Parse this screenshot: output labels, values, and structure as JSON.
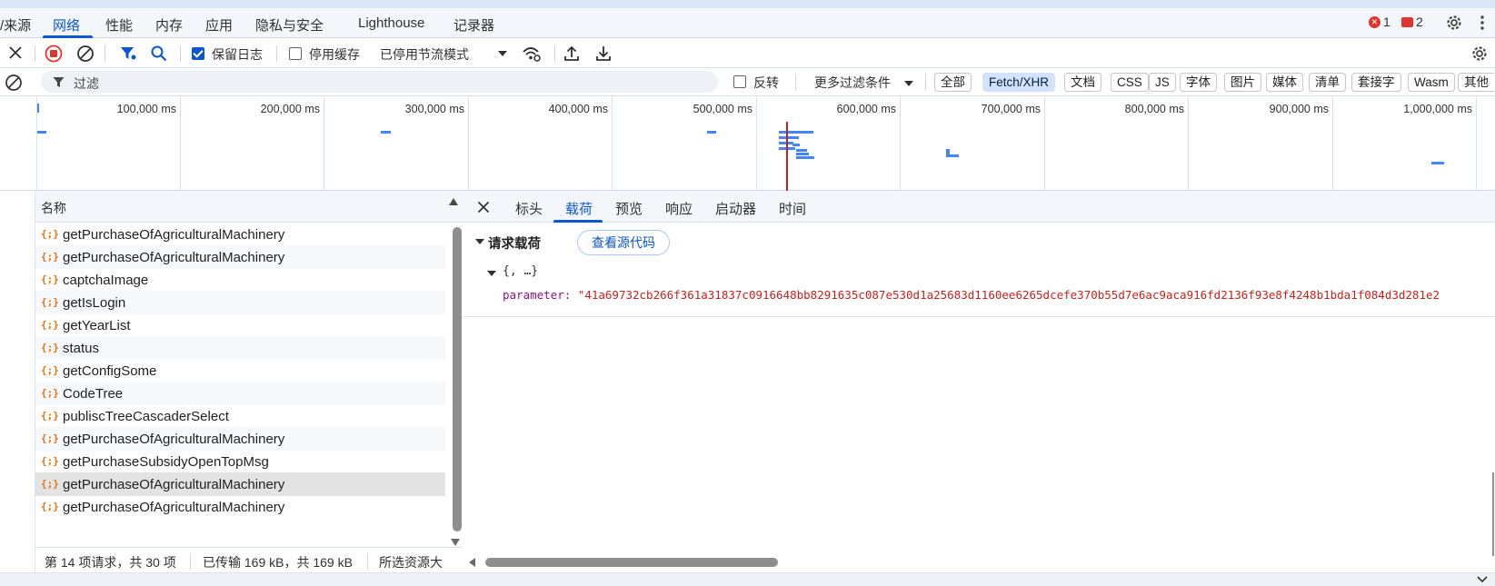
{
  "main_tabs": {
    "items": [
      {
        "label": "/来源"
      },
      {
        "label": "网络"
      },
      {
        "label": "性能"
      },
      {
        "label": "内存"
      },
      {
        "label": "应用"
      },
      {
        "label": "隐私与安全"
      },
      {
        "label": "Lighthouse"
      },
      {
        "label": "记录器"
      }
    ],
    "active": "网络",
    "errors_count": "1",
    "issues_count": "2"
  },
  "toolbar": {
    "preserve_log_label": "保留日志",
    "preserve_log_checked": true,
    "disable_cache_label": "停用缓存",
    "disable_cache_checked": false,
    "throttling_value": "已停用节流模式"
  },
  "filterbar": {
    "filter_placeholder": "过滤",
    "invert_label": "反转",
    "more_filters_label": "更多过滤条件",
    "types": [
      "全部",
      "Fetch/XHR",
      "文档",
      "CSS",
      "JS",
      "字体",
      "图片",
      "媒体",
      "清单",
      "套接字",
      "Wasm",
      "其他"
    ],
    "active_type": "Fetch/XHR"
  },
  "overview": {
    "ticks": [
      "100,000 ms",
      "200,000 ms",
      "300,000 ms",
      "400,000 ms",
      "500,000 ms",
      "600,000 ms",
      "700,000 ms",
      "800,000 ms",
      "900,000 ms",
      "1,000,000 ms"
    ]
  },
  "request_list": {
    "column_name": "名称",
    "rows": [
      "getPurchaseOfAgriculturalMachinery",
      "getPurchaseOfAgriculturalMachinery",
      "captchaImage",
      "getIsLogin",
      "getYearList",
      "status",
      "getConfigSome",
      "CodeTree",
      "publiscTreeCascaderSelect",
      "getPurchaseOfAgriculturalMachinery",
      "getPurchaseSubsidyOpenTopMsg",
      "getPurchaseOfAgriculturalMachinery",
      "getPurchaseOfAgriculturalMachinery"
    ],
    "selected_index": 11,
    "status": {
      "requests": "第 14 项请求，共 30 项",
      "transferred": "已传输 169 kB，共 169 kB",
      "resources": "所选资源大"
    }
  },
  "detail": {
    "tabs": [
      "标头",
      "载荷",
      "预览",
      "响应",
      "启动器",
      "时间"
    ],
    "active_tab": "载荷",
    "section_title": "请求载荷",
    "view_source_label": "查看源代码",
    "object_summary": "{, …}",
    "param_key": "parameter:",
    "param_value": "\"41a69732cb266f361a31837c0916648bb8291635c087e530d1a25683d1160ee6265dcefe370b55d7e6ac9aca916fd2136f93e8f4248b1bda1f084d3d281e2"
  },
  "colors": {
    "accent": "#0b57d0",
    "error": "#dc362e",
    "string_value": "#c5221f",
    "property_key": "#881280",
    "xhr_icon": "#e8710a"
  }
}
